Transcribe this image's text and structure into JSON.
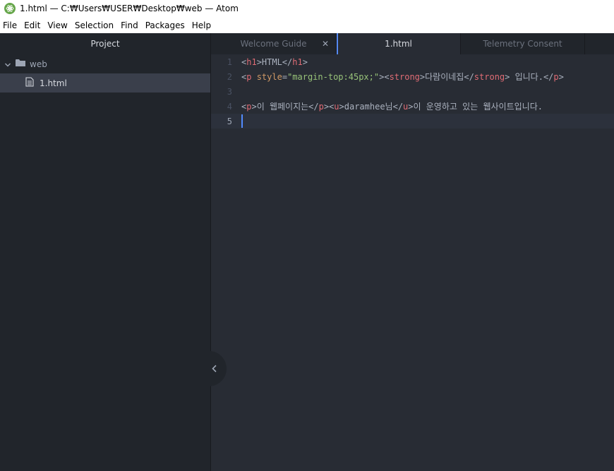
{
  "window": {
    "title": "1.html — C:₩Users₩USER₩Desktop₩web — Atom"
  },
  "menu": [
    "File",
    "Edit",
    "View",
    "Selection",
    "Find",
    "Packages",
    "Help"
  ],
  "project": {
    "header": "Project",
    "root_folder": "web",
    "files": [
      "1.html"
    ]
  },
  "tabs": [
    {
      "label": "Welcome Guide",
      "active": false,
      "has_close": true
    },
    {
      "label": "1.html",
      "active": true,
      "has_close": false
    },
    {
      "label": "Telemetry Consent",
      "active": false,
      "has_close": false
    }
  ],
  "editor": {
    "line_numbers": [
      "1",
      "2",
      "3",
      "4",
      "5"
    ],
    "current_line": 5,
    "lines": [
      [
        {
          "t": "<",
          "c": "punc"
        },
        {
          "t": "h1",
          "c": "tag"
        },
        {
          "t": ">HTML</",
          "c": "punc"
        },
        {
          "t": "h1",
          "c": "tag"
        },
        {
          "t": ">",
          "c": "punc"
        }
      ],
      [
        {
          "t": "<",
          "c": "punc"
        },
        {
          "t": "p",
          "c": "tag"
        },
        {
          "t": " ",
          "c": "punc"
        },
        {
          "t": "style",
          "c": "attr"
        },
        {
          "t": "=",
          "c": "punc"
        },
        {
          "t": "\"margin-top:45px;\"",
          "c": "str"
        },
        {
          "t": "><",
          "c": "punc"
        },
        {
          "t": "strong",
          "c": "tag"
        },
        {
          "t": ">다람이네집</",
          "c": "punc"
        },
        {
          "t": "strong",
          "c": "tag"
        },
        {
          "t": "> 입니다.</",
          "c": "punc"
        },
        {
          "t": "p",
          "c": "tag"
        },
        {
          "t": ">",
          "c": "punc"
        }
      ],
      [],
      [
        {
          "t": "<",
          "c": "punc"
        },
        {
          "t": "p",
          "c": "tag"
        },
        {
          "t": ">이 웹페이지는</",
          "c": "punc"
        },
        {
          "t": "p",
          "c": "tag"
        },
        {
          "t": "><",
          "c": "punc"
        },
        {
          "t": "u",
          "c": "tag"
        },
        {
          "t": ">daramhee님</",
          "c": "punc"
        },
        {
          "t": "u",
          "c": "tag"
        },
        {
          "t": ">이 운영하고 있는 웹사이트입니다.",
          "c": "punc"
        }
      ],
      []
    ]
  },
  "colors": {
    "accent": "#568af2",
    "cursor": "#528bff",
    "tag": "#e06c75",
    "attr": "#d19a66",
    "string": "#98c379"
  }
}
